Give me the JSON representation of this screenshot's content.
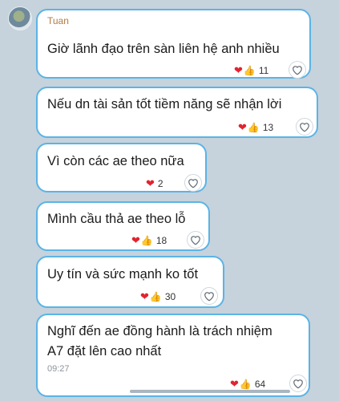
{
  "sender": {
    "name": "Tuan"
  },
  "messages": [
    {
      "text": [
        "Giờ lãnh đạo trên sàn liên hệ anh nhiều"
      ],
      "reactions": {
        "count": "11"
      }
    },
    {
      "text": [
        "Nếu dn tài sản tốt tiềm năng sẽ nhận lời"
      ],
      "reactions": {
        "count": "13"
      }
    },
    {
      "text": [
        "Vì còn các ae theo nữa"
      ],
      "reactions": {
        "count": "2"
      }
    },
    {
      "text": [
        "Mình cầu thả ae theo lỗ"
      ],
      "reactions": {
        "count": "18"
      }
    },
    {
      "text": [
        "Uy tín và sức mạnh ko tốt"
      ],
      "reactions": {
        "count": "30"
      }
    },
    {
      "text": [
        "Nghĩ đến ae đồng hành là trách nhiệm",
        "A7 đặt lên cao nhất"
      ],
      "time": "09:27",
      "reactions": {
        "count": "64"
      }
    }
  ],
  "icons": {
    "reaction_1": "heart-icon",
    "reaction_2": "thumbs-up-icon",
    "like": "heart-outline-icon"
  },
  "colors": {
    "bubble_border": "#5ab4e6",
    "sender_name": "#b07a45",
    "background": "#c6d2dc"
  }
}
